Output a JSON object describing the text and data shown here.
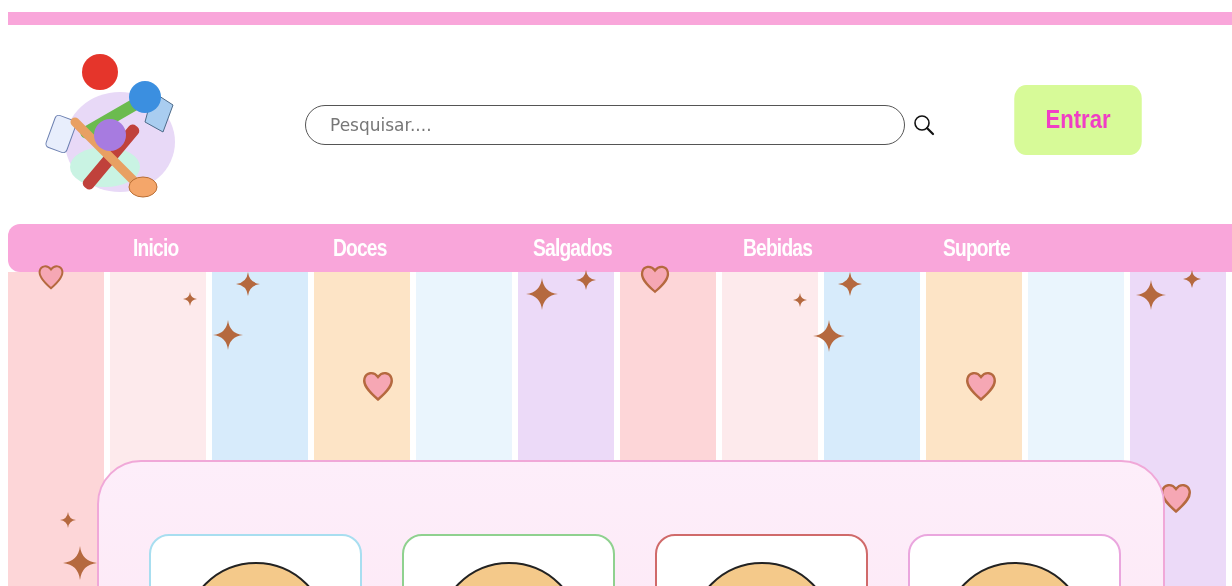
{
  "search": {
    "placeholder": "Pesquisar...."
  },
  "login_button": "Entrar",
  "nav": [
    "Inicio",
    "Doces",
    "Salgados",
    "Bebidas",
    "Suporte"
  ],
  "cards": [
    {
      "color": "#a8def0"
    },
    {
      "color": "#8fd18f"
    },
    {
      "color": "#d06a6a"
    },
    {
      "color": "#eaa6de"
    }
  ]
}
